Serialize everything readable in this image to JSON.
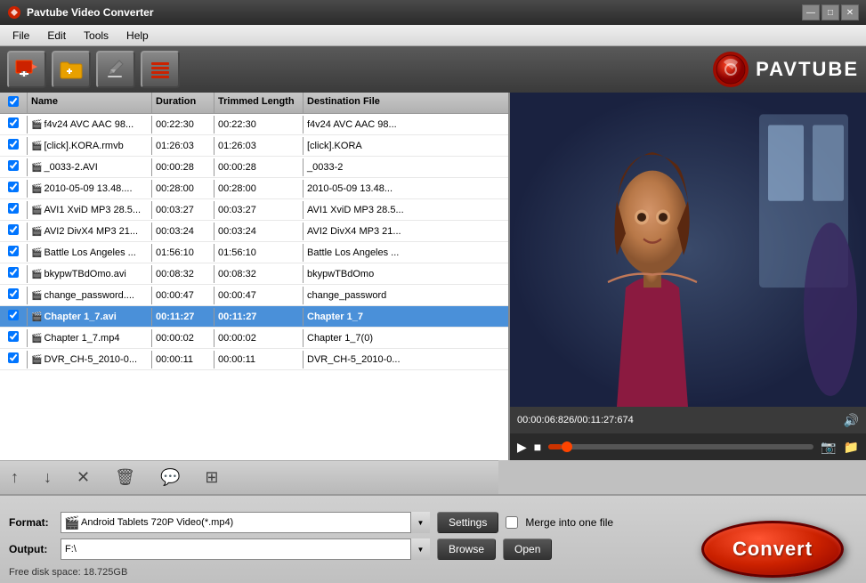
{
  "window": {
    "title": "Pavtube Video Converter",
    "controls": {
      "minimize": "—",
      "maximize": "□",
      "close": "✕"
    }
  },
  "menu": {
    "items": [
      "File",
      "Edit",
      "Tools",
      "Help"
    ]
  },
  "toolbar": {
    "buttons": [
      {
        "label": "➕🎬",
        "name": "add-video-button",
        "icon": "🎬"
      },
      {
        "label": "📁➕",
        "name": "add-folder-button",
        "icon": "📁"
      },
      {
        "label": "✏️",
        "name": "edit-button",
        "icon": "✏️"
      },
      {
        "label": "≡",
        "name": "list-button",
        "icon": "≡"
      }
    ],
    "logo": "PAVTUBE"
  },
  "file_list": {
    "columns": [
      "",
      "Name",
      "Duration",
      "Trimmed Length",
      "Destination File"
    ],
    "rows": [
      {
        "checked": true,
        "name": "f4v24 AVC AAC 98...",
        "duration": "00:22:30",
        "trimmed": "00:22:30",
        "dest": "f4v24 AVC AAC 98...",
        "selected": false
      },
      {
        "checked": true,
        "name": "[click].KORA.rmvb",
        "duration": "01:26:03",
        "trimmed": "01:26:03",
        "dest": "[click].KORA",
        "selected": false
      },
      {
        "checked": true,
        "name": "_0033-2.AVI",
        "duration": "00:00:28",
        "trimmed": "00:00:28",
        "dest": "_0033-2",
        "selected": false
      },
      {
        "checked": true,
        "name": "2010-05-09 13.48....",
        "duration": "00:28:00",
        "trimmed": "00:28:00",
        "dest": "2010-05-09 13.48...",
        "selected": false
      },
      {
        "checked": true,
        "name": "AVI1 XviD MP3 28.5...",
        "duration": "00:03:27",
        "trimmed": "00:03:27",
        "dest": "AVI1 XviD MP3 28.5...",
        "selected": false
      },
      {
        "checked": true,
        "name": "AVI2 DivX4 MP3 21...",
        "duration": "00:03:24",
        "trimmed": "00:03:24",
        "dest": "AVI2 DivX4 MP3 21...",
        "selected": false
      },
      {
        "checked": true,
        "name": "Battle Los Angeles ...",
        "duration": "01:56:10",
        "trimmed": "01:56:10",
        "dest": "Battle Los Angeles ...",
        "selected": false
      },
      {
        "checked": true,
        "name": "bkypwTBdOmo.avi",
        "duration": "00:08:32",
        "trimmed": "00:08:32",
        "dest": "bkypwTBdOmo",
        "selected": false
      },
      {
        "checked": true,
        "name": "change_password....",
        "duration": "00:00:47",
        "trimmed": "00:00:47",
        "dest": "change_password",
        "selected": false
      },
      {
        "checked": true,
        "name": "Chapter 1_7.avi",
        "duration": "00:11:27",
        "trimmed": "00:11:27",
        "dest": "Chapter 1_7",
        "selected": true
      },
      {
        "checked": true,
        "name": "Chapter 1_7.mp4",
        "duration": "00:00:02",
        "trimmed": "00:00:02",
        "dest": "Chapter 1_7(0)",
        "selected": false
      },
      {
        "checked": true,
        "name": "DVR_CH-5_2010-0...",
        "duration": "00:00:11",
        "trimmed": "00:00:11",
        "dest": "DVR_CH-5_2010-0...",
        "selected": false
      }
    ]
  },
  "preview": {
    "time_display": "00:00:06:826/00:11:27:674",
    "progress_percent": 5
  },
  "list_actions": {
    "buttons": [
      "↑",
      "↓",
      "✕",
      "🗑",
      "💬",
      "⊞"
    ]
  },
  "bottom": {
    "format_label": "Format:",
    "format_value": "Android Tablets 720P Video(*.mp4)",
    "settings_label": "Settings",
    "merge_label": "Merge into one file",
    "output_label": "Output:",
    "output_value": "F:\\",
    "browse_label": "Browse",
    "open_label": "Open",
    "diskspace": "Free disk space: 18.725GB",
    "convert_label": "Convert"
  }
}
